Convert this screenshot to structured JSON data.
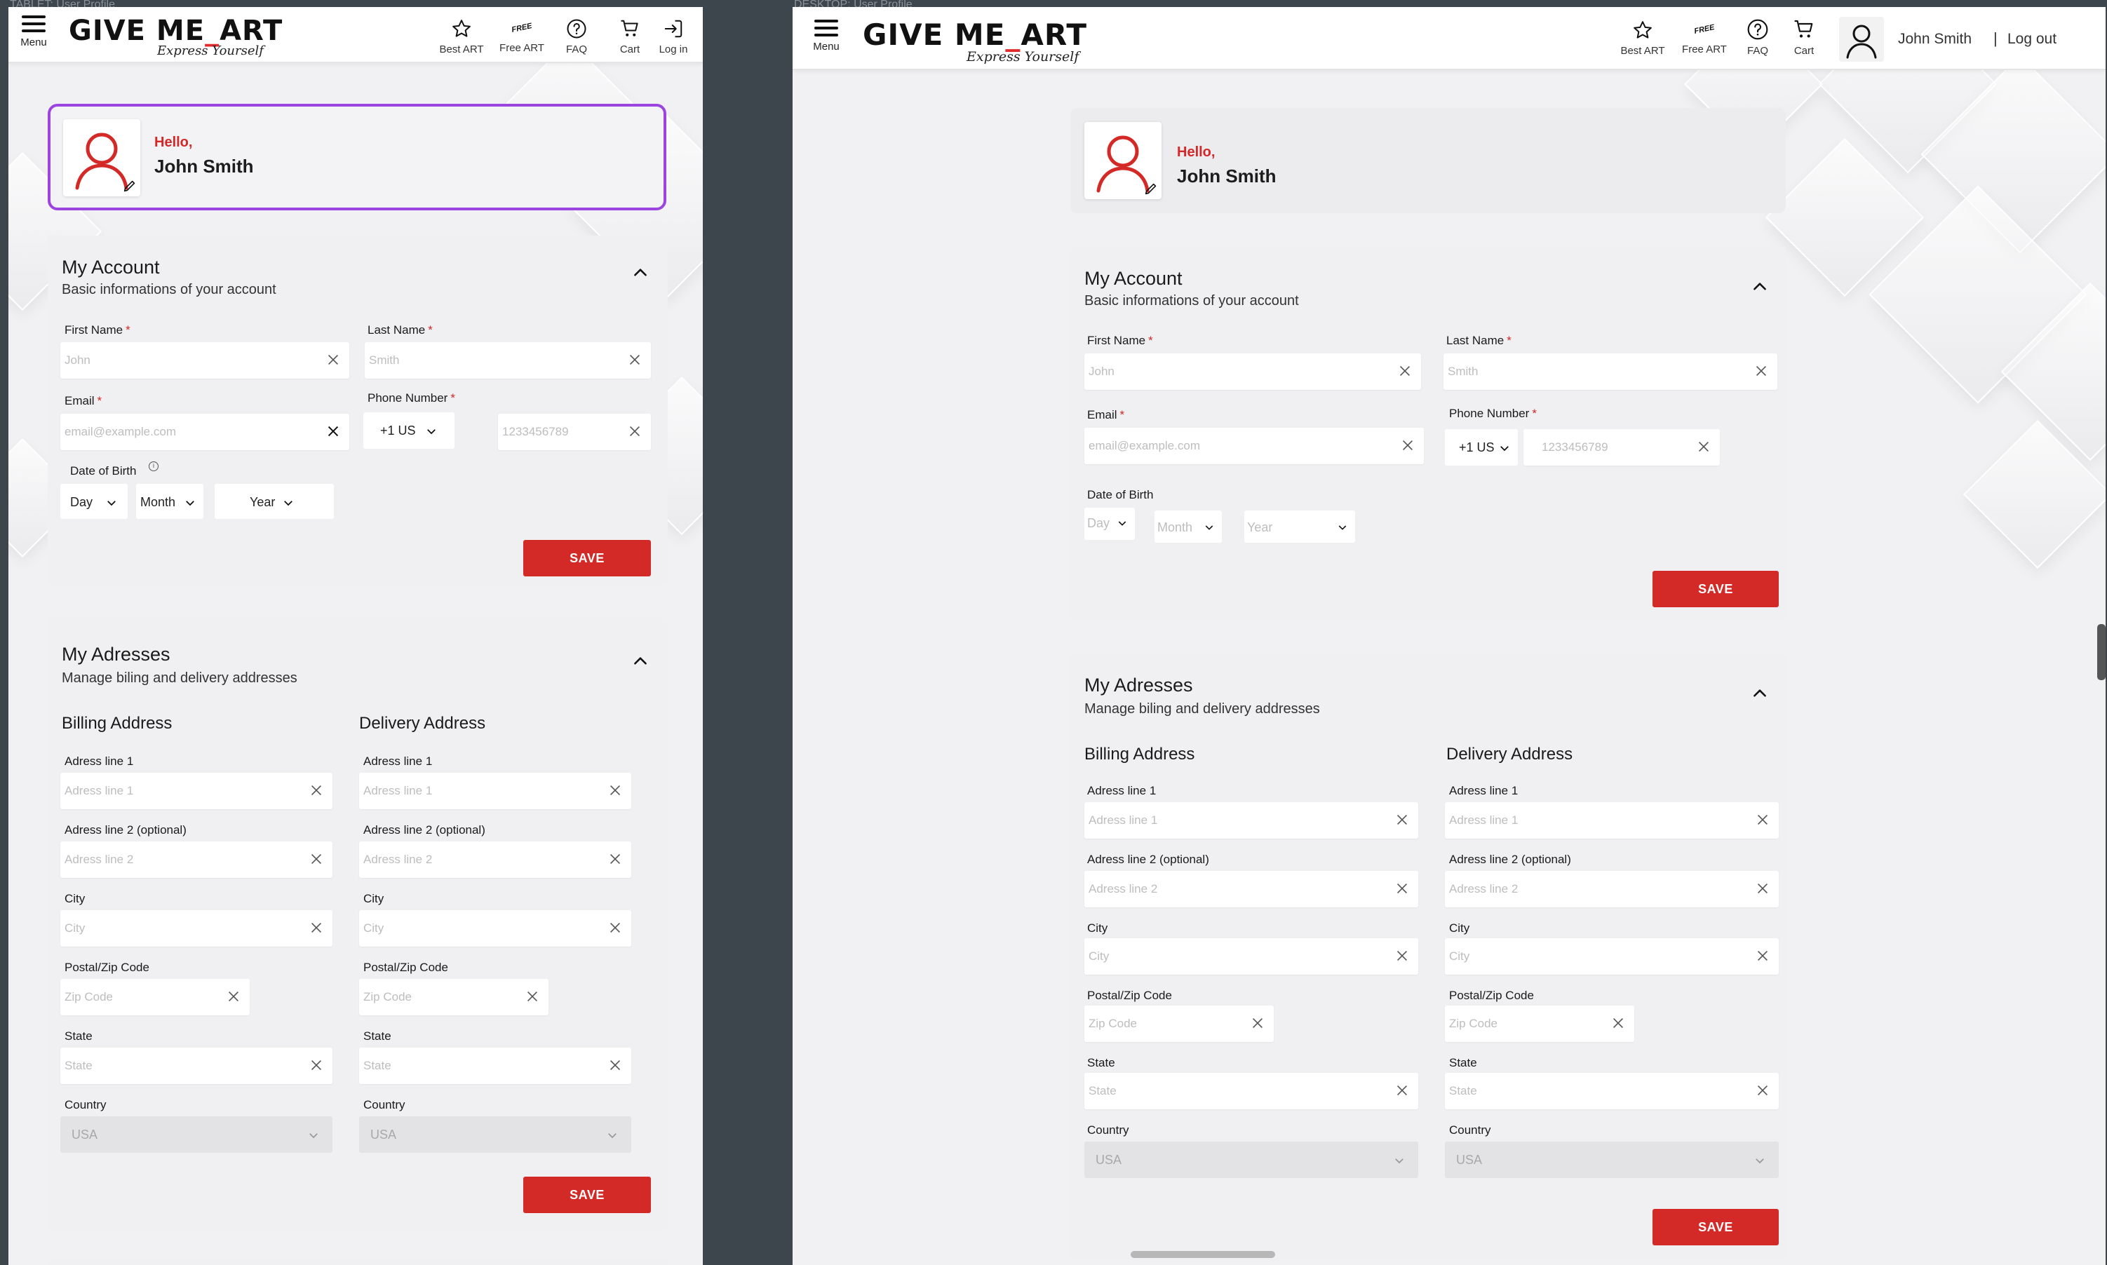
{
  "frames": {
    "tablet_label": "TABLET: User Profile",
    "desktop_label": "DESKTOP: User Profile"
  },
  "header": {
    "menu_label": "Menu",
    "logo_part1": "GIVE ME",
    "logo_dash": "_",
    "logo_part2": "ART",
    "tagline": "Express Yourself",
    "nav": {
      "best_art": "Best ART",
      "free_badge": "FREE",
      "free_art": "Free ART",
      "faq": "FAQ",
      "cart": "Cart",
      "login": "Log in",
      "user_name": "John Smith",
      "separator": "|",
      "logout": "Log out"
    }
  },
  "profile": {
    "hello": "Hello,",
    "name": "John Smith"
  },
  "account": {
    "title": "My Account",
    "subtitle": "Basic informations of your account",
    "first_name_label": "First Name",
    "first_name_ph": "John",
    "last_name_label": "Last Name",
    "last_name_ph": "Smith",
    "required_mark": "*",
    "email_label": "Email",
    "email_ph": "email@example.com",
    "phone_label": "Phone Number",
    "phone_code": "+1 US",
    "phone_ph": "1233456789",
    "dob_label": "Date of Birth",
    "info_glyph": "i",
    "day": "Day",
    "month": "Month",
    "year": "Year",
    "save": "SAVE"
  },
  "addresses": {
    "title": "My Adresses",
    "subtitle": "Manage biling and delivery addresses",
    "billing_title": "Billing Address",
    "delivery_title": "Delivery Address",
    "line1_label": "Adress line 1",
    "line1_ph": "Adress line 1",
    "line2_label": "Adress line 2 (optional)",
    "line2_ph": "Adress line 2",
    "city_label": "City",
    "city_ph": "City",
    "zip_label": "Postal/Zip Code",
    "zip_ph": "Zip Code",
    "state_label": "State",
    "state_ph": "State",
    "country_label": "Country",
    "country_val": "USA",
    "save": "SAVE"
  },
  "colors": {
    "accent_red": "#d42a27",
    "selection_purple": "#9b44e0",
    "frame_bg": "#3d464d"
  },
  "icons": [
    "menu-icon",
    "star-icon",
    "free-icon",
    "help-icon",
    "cart-icon",
    "login-icon",
    "user-icon",
    "pencil-icon",
    "chevron-up-icon",
    "chevron-down-icon",
    "close-icon",
    "info-icon"
  ]
}
